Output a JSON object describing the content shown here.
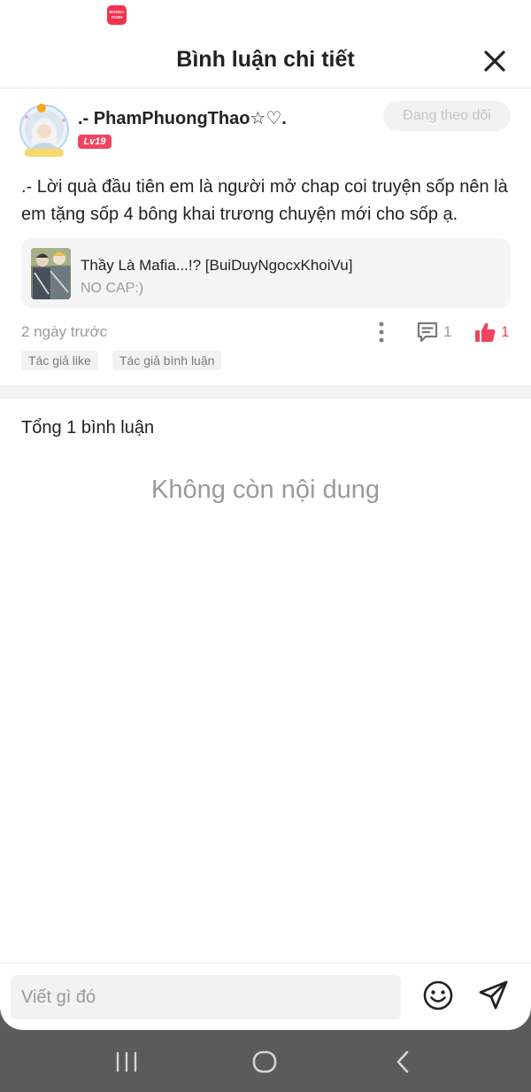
{
  "app": {
    "icon_text": "MANGA TOON"
  },
  "header": {
    "title": "Bình luận chi tiết"
  },
  "comment": {
    "username": ".- PhamPhuongThao☆♡.",
    "level": "Lv19",
    "follow_label": "Đang theo dõi",
    "text": ".- Lời quà đầu tiên em là người mở chap coi truyện sốp nên là em tặng sốp 4 bông khai trương chuyện mới cho sốp ạ.",
    "story": {
      "title": "Thầy Là Mafia...!? [BuiDuyNgocxKhoiVu]",
      "subtitle": "NO CAP:)"
    },
    "time": "2 ngày trước",
    "reply_count": "1",
    "like_count": "1",
    "tags": [
      "Tác giả like",
      "Tác giả bình luận"
    ]
  },
  "replies": {
    "total_label": "Tổng 1 bình luận",
    "empty_label": "Không còn nội dung"
  },
  "input": {
    "placeholder": "Viết gì đó"
  },
  "colors": {
    "accent": "#f2445f",
    "muted": "#9a9a9a",
    "nav_bg": "#5b5b5b"
  }
}
